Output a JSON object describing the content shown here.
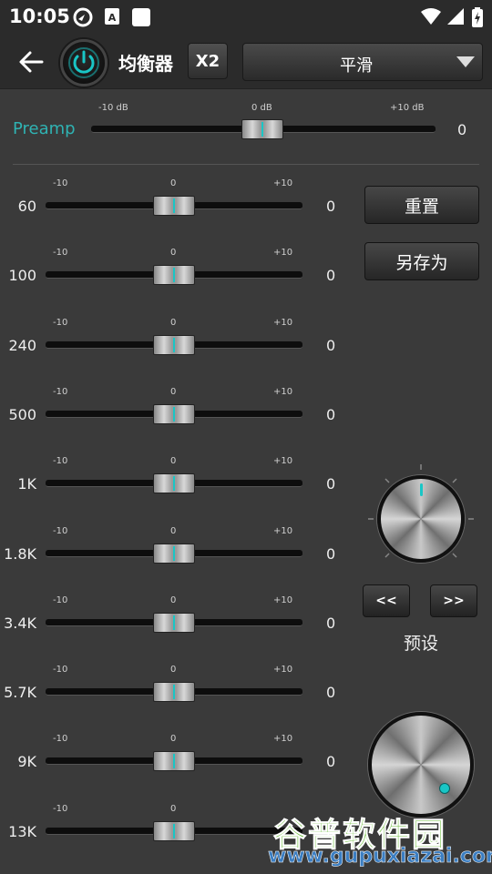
{
  "status_bar": {
    "time": "10:05"
  },
  "toolbar": {
    "title": "均衡器",
    "x2_label": "X2",
    "preset_value": "平滑"
  },
  "preamp": {
    "label": "Preamp",
    "tick_left": "-10 dB",
    "tick_mid": "0 dB",
    "tick_right": "+10 dB",
    "value": "0",
    "level": 0
  },
  "bands": [
    {
      "label": "60",
      "value": "0",
      "tick_left": "-10",
      "tick_mid": "0",
      "tick_right": "+10"
    },
    {
      "label": "100",
      "value": "0",
      "tick_left": "-10",
      "tick_mid": "0",
      "tick_right": "+10"
    },
    {
      "label": "240",
      "value": "0",
      "tick_left": "-10",
      "tick_mid": "0",
      "tick_right": "+10"
    },
    {
      "label": "500",
      "value": "0",
      "tick_left": "-10",
      "tick_mid": "0",
      "tick_right": "+10"
    },
    {
      "label": "1K",
      "value": "0",
      "tick_left": "-10",
      "tick_mid": "0",
      "tick_right": "+10"
    },
    {
      "label": "1.8K",
      "value": "0",
      "tick_left": "-10",
      "tick_mid": "0",
      "tick_right": "+10"
    },
    {
      "label": "3.4K",
      "value": "0",
      "tick_left": "-10",
      "tick_mid": "0",
      "tick_right": "+10"
    },
    {
      "label": "5.7K",
      "value": "0",
      "tick_left": "-10",
      "tick_mid": "0",
      "tick_right": "+10"
    },
    {
      "label": "9K",
      "value": "0",
      "tick_left": "-10",
      "tick_mid": "0",
      "tick_right": "+10"
    },
    {
      "label": "13K",
      "value": "0",
      "tick_left": "-10",
      "tick_mid": "0",
      "tick_right": ""
    }
  ],
  "side": {
    "reset_label": "重置",
    "save_as_label": "另存为",
    "prev_label": "<<",
    "next_label": ">>",
    "preset_label": "预设"
  },
  "watermark": {
    "line1": "谷普软件园",
    "line2": "www.gupuxiazai.com"
  },
  "colors": {
    "accent": "#19c6c6",
    "preamp_label": "#2fb3b3",
    "background": "#3a3a3a",
    "toolbar": "#2b2b2b"
  },
  "icons": [
    "back-arrow-icon",
    "power-icon",
    "chevron-down-icon",
    "wifi-icon",
    "signal-icon",
    "battery-icon"
  ]
}
